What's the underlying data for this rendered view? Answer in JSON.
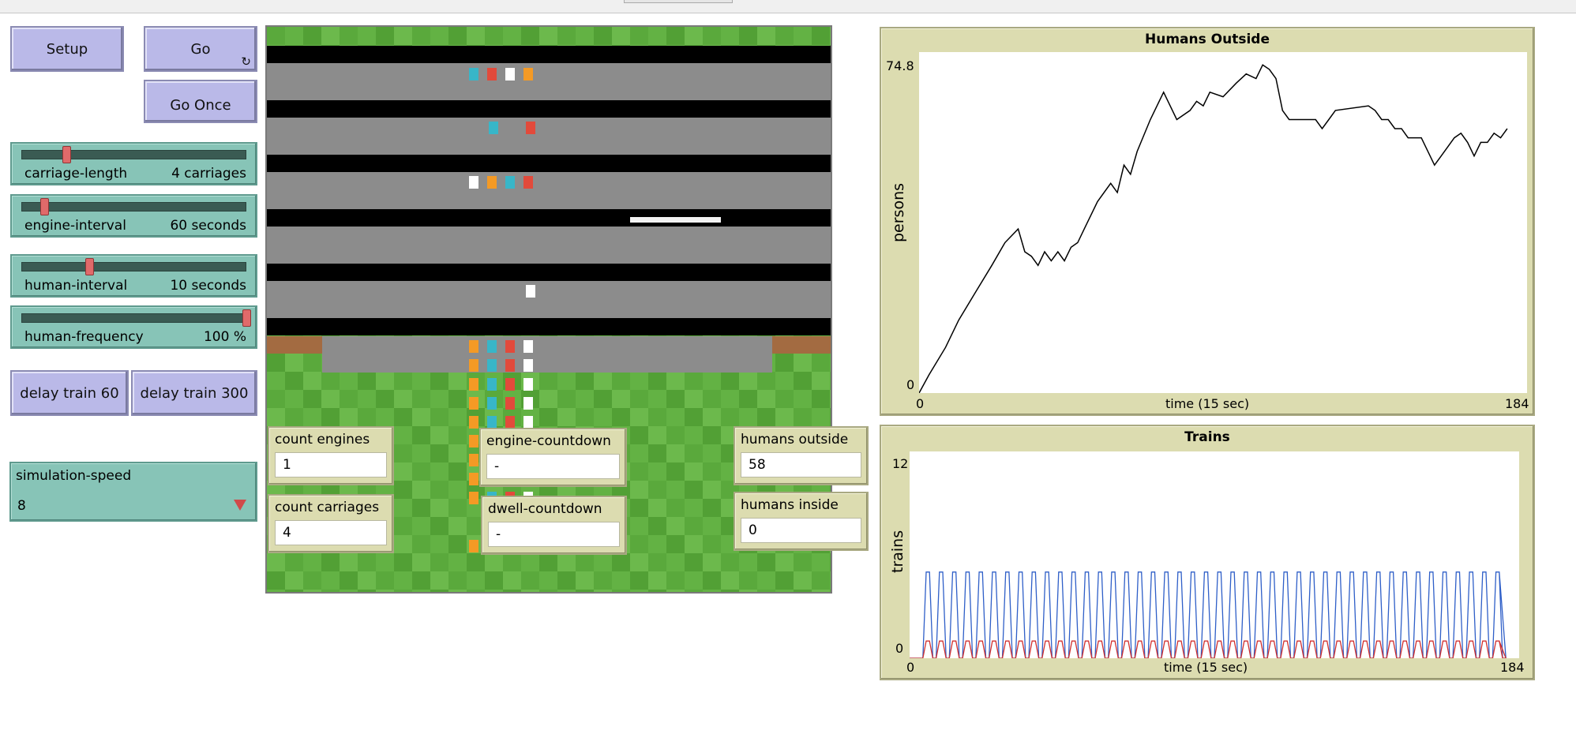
{
  "buttons": {
    "setup": "Setup",
    "go": "Go",
    "go_forever_glyph": "↻",
    "go_once": "Go Once",
    "delay_train_60": "delay train 60",
    "delay_train_300": "delay train 300"
  },
  "sliders": [
    {
      "label": "carriage-length",
      "value": "4 carriages",
      "fraction": 0.2
    },
    {
      "label": "engine-interval",
      "value": "60 seconds",
      "fraction": 0.1
    },
    {
      "label": "human-interval",
      "value": "10 seconds",
      "fraction": 0.3
    },
    {
      "label": "human-frequency",
      "value": "100 %",
      "fraction": 1.0
    }
  ],
  "chooser": {
    "label": "simulation-speed",
    "value": "8"
  },
  "monitors": {
    "count_engines": {
      "label": "count engines",
      "value": "1"
    },
    "count_carriages": {
      "label": "count carriages",
      "value": "4"
    },
    "engine_countdown": {
      "label": "engine-countdown",
      "value": "-"
    },
    "dwell_countdown": {
      "label": "dwell-countdown",
      "value": "-"
    },
    "humans_outside": {
      "label": "humans outside",
      "value": "58"
    },
    "humans_inside": {
      "label": "humans inside",
      "value": "0"
    }
  },
  "plots": {
    "humans_outside": {
      "title": "Humans Outside",
      "ylabel": "persons",
      "xlabel": "time (15 sec)",
      "ymin": "0",
      "ymax": "74.8",
      "xmin": "0",
      "xmax": "184"
    },
    "trains": {
      "title": "Trains",
      "ylabel": "trains",
      "xlabel": "time (15 sec)",
      "ymin": "0",
      "ymax": "12",
      "xmin": "0",
      "xmax": "184"
    }
  },
  "colors": {
    "button": "#bab9e8",
    "slider": "#87c4b7",
    "monitor": "#dcdcb0",
    "plot_line": "#000000",
    "trains_series_blue": "#2f5fc8",
    "trains_series_red": "#d03030"
  },
  "chart_data": [
    {
      "type": "line",
      "title": "Humans Outside",
      "xlabel": "time (15 sec)",
      "ylabel": "persons",
      "xlim": [
        0,
        184
      ],
      "ylim": [
        0,
        74.8
      ],
      "series": [
        {
          "x": [
            0,
            3,
            8,
            12,
            17,
            22,
            26,
            30,
            32,
            34,
            36,
            38,
            40,
            42,
            44,
            46,
            48,
            50,
            54,
            58,
            60,
            62,
            64,
            66,
            70,
            74,
            78,
            82,
            84,
            86,
            88,
            92,
            96,
            99,
            102,
            104,
            106,
            108,
            110,
            112,
            114,
            116,
            118,
            120,
            122,
            124,
            126,
            136,
            138,
            140,
            142,
            144,
            146,
            148,
            150,
            152,
            156,
            158,
            160,
            162,
            164,
            166,
            168,
            170,
            172,
            174,
            176,
            178
          ],
          "y": [
            0,
            4,
            10,
            16,
            22,
            28,
            33,
            36,
            31,
            30,
            28,
            31,
            29,
            31,
            29,
            32,
            33,
            36,
            42,
            46,
            44,
            50,
            48,
            53,
            60,
            66,
            60,
            62,
            64,
            63,
            66,
            65,
            68,
            70,
            69,
            72,
            71,
            69,
            62,
            60,
            60,
            60,
            60,
            60,
            58,
            60,
            62,
            63,
            62,
            60,
            60,
            58,
            58,
            56,
            56,
            56,
            50,
            52,
            54,
            56,
            57,
            55,
            52,
            55,
            55,
            57,
            56,
            58
          ]
        }
      ]
    },
    {
      "type": "line",
      "title": "Trains",
      "xlabel": "time (15 sec)",
      "ylabel": "trains",
      "xlim": [
        0,
        184
      ],
      "ylim": [
        0,
        12
      ],
      "series": [
        {
          "pattern": "oscillating",
          "high": 5,
          "low": 0,
          "period": 4,
          "start": 4,
          "end": 178
        },
        {
          "pattern": "oscillating",
          "high": 1,
          "low": 0,
          "period": 4,
          "start": 4,
          "end": 178
        }
      ]
    }
  ]
}
